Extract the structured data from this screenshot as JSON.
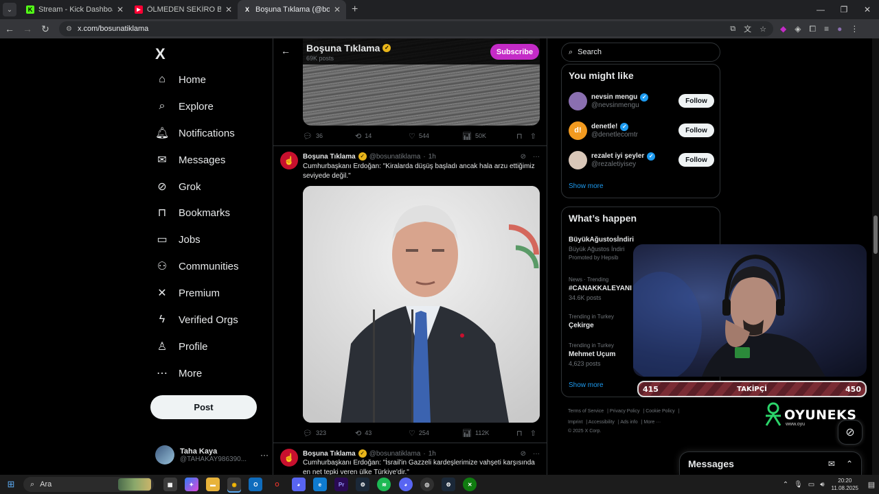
{
  "browser": {
    "tabs": [
      {
        "title": "Stream - Kick Dashboard",
        "favicon": "K",
        "favicon_color": "#53fc18",
        "active": false
      },
      {
        "title": "ÖLMEDEN SEKİRO BİTİRDİM! (Ç",
        "favicon": "▶",
        "favicon_color": "#ff0033",
        "active": false
      },
      {
        "title": "Boşuna Tıklama (@bosunatiklam",
        "favicon": "X",
        "favicon_color": "#ffffff",
        "active": true
      }
    ],
    "url": "x.com/bosunatiklama",
    "new_tab_icon": "+"
  },
  "nav": {
    "logo": "X",
    "items": [
      {
        "label": "Home",
        "icon": "⌂"
      },
      {
        "label": "Explore",
        "icon": "⌕"
      },
      {
        "label": "Notifications",
        "icon": "🔔︎"
      },
      {
        "label": "Messages",
        "icon": "✉"
      },
      {
        "label": "Grok",
        "icon": "⊘"
      },
      {
        "label": "Bookmarks",
        "icon": "⊓"
      },
      {
        "label": "Jobs",
        "icon": "▭"
      },
      {
        "label": "Communities",
        "icon": "⚇"
      },
      {
        "label": "Premium",
        "icon": "✕"
      },
      {
        "label": "Verified Orgs",
        "icon": "ϟ"
      },
      {
        "label": "Profile",
        "icon": "♙"
      },
      {
        "label": "More",
        "icon": "⋯"
      }
    ],
    "post_label": "Post",
    "user": {
      "name": "Taha Kaya",
      "handle": "@TAHAKAY986390..."
    }
  },
  "profile_header": {
    "name": "Boşuna Tıklama",
    "posts": "69K posts",
    "subscribe_label": "Subscribe"
  },
  "first_post_actions": {
    "replies": "36",
    "reposts": "14",
    "likes": "544",
    "views": "50K"
  },
  "posts": [
    {
      "author": "Boşuna Tıklama",
      "handle": "@bosunatiklama",
      "time": "1h",
      "text": "Cumhurbaşkanı Erdoğan: \"Kiralarda düşüş başladı ancak hala arzu ettiğimiz seviyede değil.\"",
      "replies": "323",
      "reposts": "43",
      "likes": "254",
      "views": "112K"
    },
    {
      "author": "Boşuna Tıklama",
      "handle": "@bosunatiklama",
      "time": "1h",
      "text": "Cumhurbaşkanı Erdoğan: \"İsrail'in Gazzeli kardeşlerimize vahşeti karşısında en net tepki veren ülke Türkiye'dir.\""
    }
  ],
  "photo_backdrop_text": "LİSTİN'İ\nLEYEN\nLAR\nUBU",
  "search_placeholder": "Search",
  "you_might_like": {
    "title": "You might like",
    "accounts": [
      {
        "name": "nevsin mengu",
        "handle": "@nevsinmengu",
        "avatar_color": "#8a6fb0",
        "initial": ""
      },
      {
        "name": "denetle!",
        "handle": "@denetlecomtr",
        "avatar_color": "#f29a1f",
        "initial": "d!"
      },
      {
        "name": "rezalet iyi şeyler",
        "handle": "@rezaletiyisey",
        "avatar_color": "#d9c7b8",
        "initial": ""
      }
    ],
    "follow_label": "Follow",
    "show_more": "Show more"
  },
  "whats_happening": {
    "title": "What’s happen",
    "trends": [
      {
        "meta": "",
        "name": "BüyükAğustosİndiri",
        "posts": "Büyük Ağustos İndiri",
        "promo": "Promoted by Hepsib"
      },
      {
        "meta": "News · Trending",
        "name": "#CANAKKALEYANI",
        "posts": "34.6K posts"
      },
      {
        "meta": "Trending in Turkey",
        "name": "Çekirge",
        "posts": ""
      },
      {
        "meta": "Trending in Turkey",
        "name": "Mehmet Uçum",
        "posts": "4,623 posts"
      }
    ],
    "show_more": "Show more"
  },
  "footer_links": [
    "Terms of Service",
    "Privacy Policy",
    "Cookie Policy",
    "Imprint",
    "Accessibility",
    "Ads info",
    "More ···",
    "© 2025 X Corp."
  ],
  "messages_label": "Messages",
  "stream_overlay": {
    "follower_current": "415",
    "follower_label": "TAKİPÇİ",
    "follower_goal": "450",
    "brand": "OYUNEKS",
    "brand_sub": "www.oyu"
  },
  "taskbar": {
    "search_label": "Ara",
    "time": "20:20",
    "date": "11.08.2025"
  }
}
